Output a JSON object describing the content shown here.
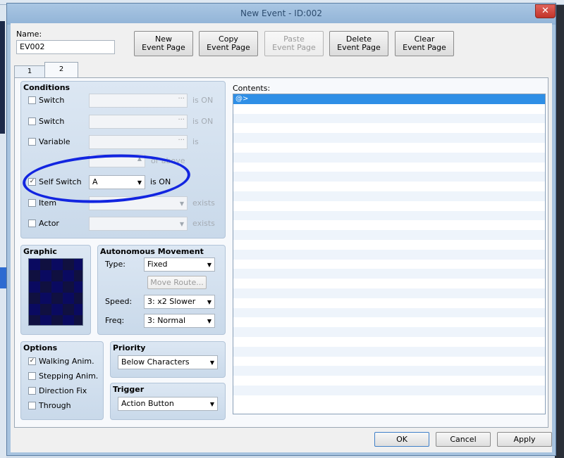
{
  "window": {
    "title": "New Event - ID:002"
  },
  "name_field": {
    "label": "Name:",
    "value": "EV002"
  },
  "toolbar": {
    "new_event_page": [
      "New",
      "Event Page"
    ],
    "copy_event_page": [
      "Copy",
      "Event Page"
    ],
    "paste_event_page": [
      "Paste",
      "Event Page"
    ],
    "delete_event_page": [
      "Delete",
      "Event Page"
    ],
    "clear_event_page": [
      "Clear",
      "Event Page"
    ]
  },
  "tabs": [
    "1",
    "2"
  ],
  "conditions": {
    "title": "Conditions",
    "switch1": {
      "label": "Switch",
      "checked": false,
      "suffix": "is ON"
    },
    "switch2": {
      "label": "Switch",
      "checked": false,
      "suffix": "is ON"
    },
    "variable": {
      "label": "Variable",
      "checked": false,
      "suffix": "is",
      "below_suffix": "or above"
    },
    "self_switch": {
      "label": "Self Switch",
      "checked": true,
      "value": "A",
      "suffix": "is ON"
    },
    "item": {
      "label": "Item",
      "checked": false,
      "suffix": "exists"
    },
    "actor": {
      "label": "Actor",
      "checked": false,
      "suffix": "exists"
    }
  },
  "graphic": {
    "title": "Graphic"
  },
  "autonomous_movement": {
    "title": "Autonomous Movement",
    "type_label": "Type:",
    "type_value": "Fixed",
    "move_route": "Move Route...",
    "speed_label": "Speed:",
    "speed_value": "3: x2 Slower",
    "freq_label": "Freq:",
    "freq_value": "3: Normal"
  },
  "options": {
    "title": "Options",
    "walking_anim": {
      "label": "Walking Anim.",
      "checked": true
    },
    "stepping_anim": {
      "label": "Stepping Anim.",
      "checked": false
    },
    "direction_fix": {
      "label": "Direction Fix",
      "checked": false
    },
    "through": {
      "label": "Through",
      "checked": false
    }
  },
  "priority": {
    "title": "Priority",
    "value": "Below Characters"
  },
  "trigger": {
    "title": "Trigger",
    "value": "Action Button"
  },
  "contents": {
    "label": "Contents:",
    "first_line": "@>"
  },
  "footer": {
    "ok": "OK",
    "cancel": "Cancel",
    "apply": "Apply"
  },
  "colors": {
    "annotation": "#1225e0",
    "selection": "#2f8fe6"
  }
}
